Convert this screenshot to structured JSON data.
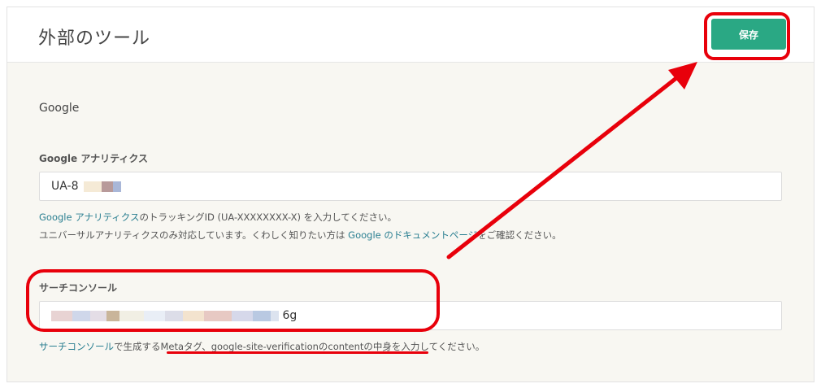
{
  "header": {
    "title": "外部のツール",
    "save_label": "保存"
  },
  "google": {
    "section_title": "Google",
    "analytics": {
      "label": "Google アナリティクス",
      "value_prefix": "UA-8",
      "help_line1_link": "Google アナリティクス",
      "help_line1_rest": "のトラッキングID (UA-XXXXXXXX-X) を入力してください。",
      "help_line2_pre": "ユニバーサルアナリティクスのみ対応しています。くわしく知りたい方は ",
      "help_line2_link": "Google のドキュメントページ",
      "help_line2_post": "をご確認ください。"
    },
    "search_console": {
      "label": "サーチコンソール",
      "value_suffix": "6g",
      "help_link": "サーチコンソール",
      "help_rest": "で生成するMetaタグ、google-site-verificationのcontentの中身を入力してください。"
    }
  },
  "colors": {
    "accent": "#2aa884",
    "link": "#2a7f91",
    "annotation": "#e8000b"
  }
}
